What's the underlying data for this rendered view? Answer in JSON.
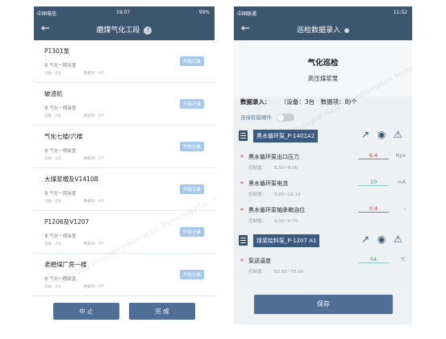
{
  "left": {
    "status": {
      "carrier": "中国电信",
      "time": "19:07",
      "battery": "99%"
    },
    "title": "磨煤气化工段",
    "items": [
      {
        "name": "P1301泵",
        "location": "气化一期装置",
        "equip": "设备：0台",
        "data": "数据项：0个",
        "action": "开始记录"
      },
      {
        "name": "破渣机",
        "location": "气化一期装置",
        "equip": "设备：0台",
        "data": "数据项：0个",
        "action": "开始记录"
      },
      {
        "name": "气化七楼/六楼",
        "location": "气化一期装置",
        "equip": "设备：0台",
        "data": "数据项：0个",
        "action": "开始记录"
      },
      {
        "name": "大煤浆槽及V1410B",
        "location": "气化一期装置",
        "equip": "设备：0台",
        "data": "数据项：0个",
        "action": "开始记录"
      },
      {
        "name": "P1206及V1207",
        "location": "气化一期装置",
        "equip": "设备：0台",
        "data": "数据项：0个",
        "action": "开始记录"
      },
      {
        "name": "老磨煤厂房一楼",
        "location": "气化一期装置",
        "equip": "设备：0台",
        "data": "数据项：0个",
        "action": "开始记录"
      }
    ],
    "buttons": {
      "stop": "中 止",
      "done": "完 成"
    }
  },
  "right": {
    "status": {
      "carrier": "中国联通",
      "time": "11:52"
    },
    "title": "巡检数据录入",
    "form_title": "气化巡检",
    "form_sub": "高压煤浆泵",
    "entry_label": "数据录入：",
    "entry_counts": "（设备：3台　数据项：8)个",
    "connect_label": "连接智能硬件",
    "devices": [
      {
        "name": "黑水循环泵_P-1401A2"
      },
      {
        "name": "煤浆给料泵_P-1207 A1"
      }
    ],
    "params": [
      {
        "name": "黑水循环泵出口压力",
        "value": "6.4",
        "unit": "Mpa",
        "range_label": "控制值：",
        "range": "6.50~8.00"
      },
      {
        "name": "黑水循环泵电流",
        "value": "10",
        "unit": "mA",
        "range_label": "控制值：",
        "range": "0.00~16.10"
      },
      {
        "name": "黑水循环泵轴承箱油位",
        "value": "0.4",
        "unit": "-",
        "range_label": "控制值：",
        "range": "0.50~0.70"
      },
      {
        "name": "泵送温度",
        "value": "54",
        "unit": "℃",
        "range_label": "控制值：",
        "range": "50.00~70.00"
      }
    ],
    "save": "保存"
  },
  "watermark": "Shanghai Hanchen Information Technology Co., Ltd."
}
